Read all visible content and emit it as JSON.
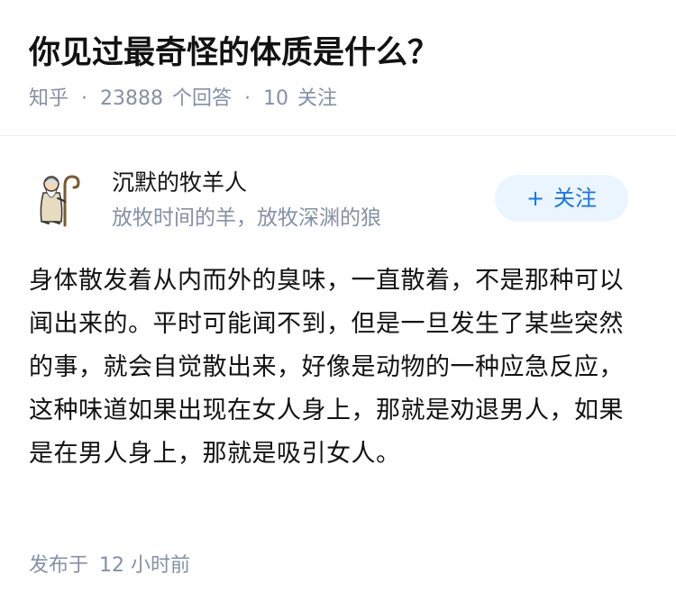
{
  "question": {
    "title": "你见过最奇怪的体质是什么？",
    "source": "知乎",
    "answer_count": "23888",
    "answer_count_label": "个回答",
    "follower_count": "10",
    "follower_label": "关注",
    "separator": "·"
  },
  "author": {
    "name": "沉默的牧羊人",
    "bio": "放牧时间的羊，放牧深渊的狼",
    "avatar_icon": "shepherd-avatar-icon",
    "follow_plus": "+",
    "follow_label": "关注"
  },
  "answer": {
    "content": "身体散发着从内而外的臭味，一直散着，不是那种可以闻出来的。平时可能闻不到，但是一旦发生了某些突然的事，就会自觉散出来，好像是动物的一种应急反应，这种味道如果出现在女人身上，那就是劝退男人，如果是在男人身上，那就是吸引女人。",
    "published_prefix": "发布于",
    "published_time": "12 小时前"
  },
  "colors": {
    "accent": "#1772f6",
    "follow_bg": "#ebf5ff",
    "meta": "#8590a6",
    "text": "#121212"
  }
}
